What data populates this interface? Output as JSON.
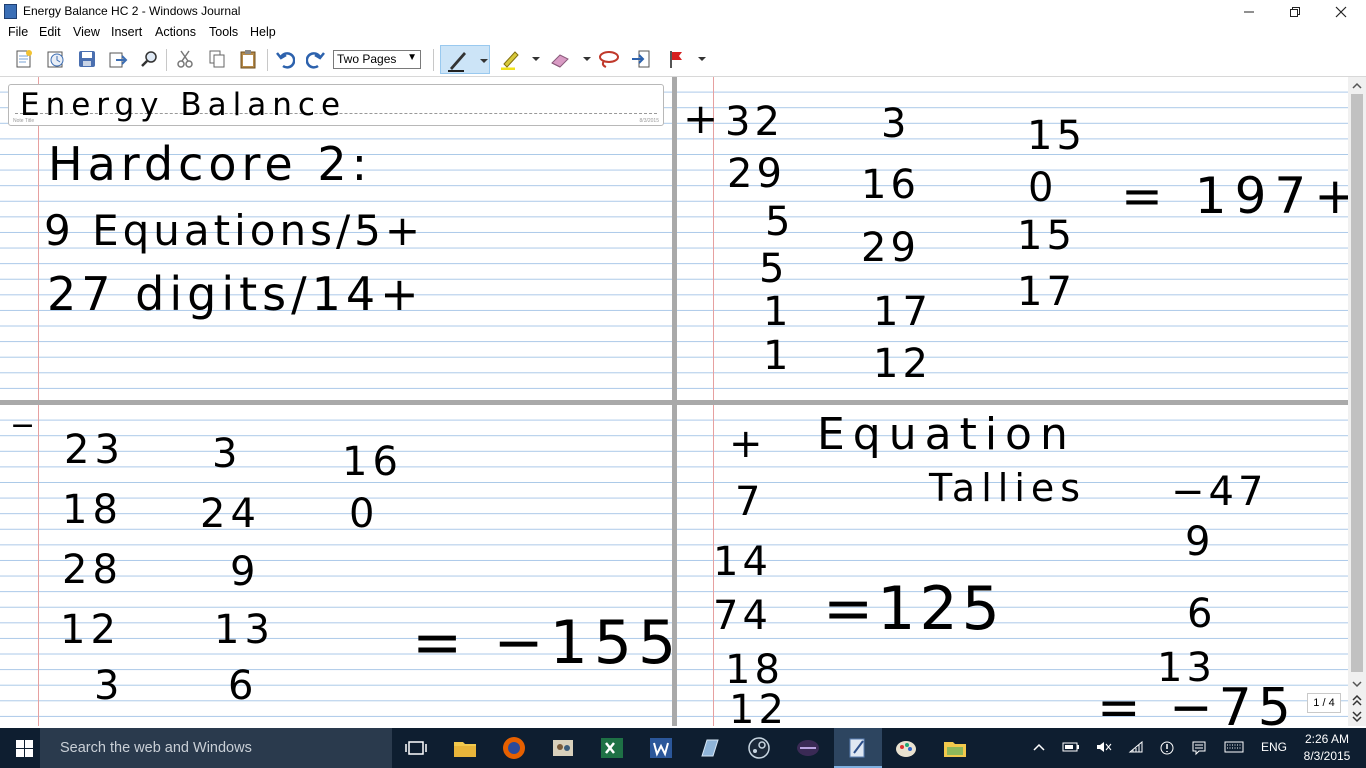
{
  "window": {
    "title": "Energy Balance HC 2 - Windows Journal"
  },
  "menu": [
    "File",
    "Edit",
    "View",
    "Insert",
    "Actions",
    "Tools",
    "Help"
  ],
  "toolbar": {
    "view_select": "Two Pages"
  },
  "note": {
    "title_ink": "Energy Balance",
    "title_field_label": "Note Title",
    "title_field_date": "8/3/2015",
    "pages": [
      {
        "lines": [
          "Hardcore 2:",
          "9 Equations/5+",
          "27 digits/14+"
        ]
      },
      {
        "columns": [
          [
            "32",
            "29",
            "5",
            "5",
            "1",
            "1"
          ],
          [
            "3",
            "16",
            "29",
            "17",
            "12"
          ],
          [
            "15",
            "0",
            "15",
            "17"
          ]
        ],
        "sign": "+",
        "result": "= 197+"
      },
      {
        "columns": [
          [
            "23",
            "18",
            "28",
            "12",
            "3"
          ],
          [
            "3",
            "24",
            "9",
            "13",
            "6"
          ],
          [
            "16",
            "0"
          ]
        ],
        "sign": "−",
        "result": "= −155"
      },
      {
        "sign": "+",
        "heading": "Equation",
        "subheading": "Tallies",
        "left_values": [
          "7",
          "14",
          "74",
          "18",
          "12"
        ],
        "left_result": "=125",
        "right_values": [
          "−47",
          "9",
          "6",
          "13"
        ],
        "right_result": "= −75"
      }
    ]
  },
  "page_indicator": "1 / 4",
  "taskbar": {
    "search_placeholder": "Search the web and Windows",
    "language": "ENG",
    "time": "2:26 AM",
    "date": "8/3/2015"
  }
}
